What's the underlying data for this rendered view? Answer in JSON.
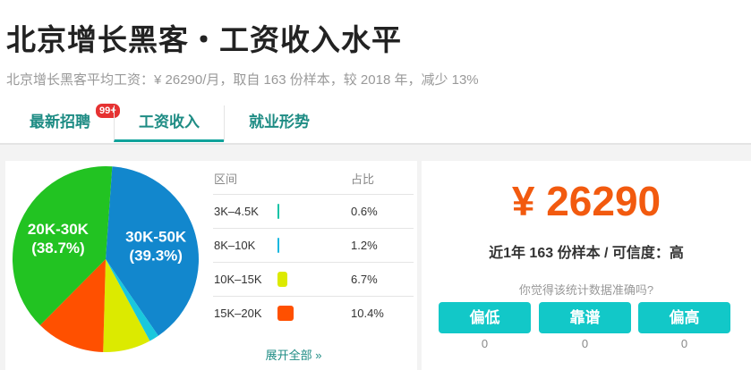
{
  "header": {
    "title": "北京增长黑客・工资收入水平",
    "subtitle": "北京增长黑客平均工资：¥ 26290/月，取自 163 份样本，较 2018 年，减少 13%"
  },
  "tabs": [
    {
      "label": "最新招聘",
      "badge": "99+"
    },
    {
      "label": "工资收入",
      "active": true
    },
    {
      "label": "就业形势"
    }
  ],
  "chart_data": {
    "type": "pie",
    "slices": [
      {
        "label": "30K-50K",
        "percent": 39.3,
        "color": "#1287cd"
      },
      {
        "label": "",
        "percent": 1.7,
        "color": "#19c8dd"
      },
      {
        "label": "",
        "percent": 8.3,
        "color": "#dcea00"
      },
      {
        "label": "",
        "percent": 12.0,
        "color": "#ff5000"
      },
      {
        "label": "20K-30K",
        "percent": 38.7,
        "color": "#22c322"
      }
    ]
  },
  "table": {
    "headers": [
      "区间",
      "占比"
    ],
    "rows": [
      {
        "range": "3K–4.5K",
        "percent": "0.6%",
        "value": 0.6,
        "color": "#11c3a6"
      },
      {
        "range": "8K–10K",
        "percent": "1.2%",
        "value": 1.2,
        "color": "#19b8e0"
      },
      {
        "range": "10K–15K",
        "percent": "6.7%",
        "value": 6.7,
        "color": "#dcea00"
      },
      {
        "range": "15K–20K",
        "percent": "10.4%",
        "value": 10.4,
        "color": "#ff5000"
      }
    ],
    "more_label": "展开全部 »"
  },
  "summary": {
    "salary": "¥ 26290",
    "sample": "近1年 163 份样本 / 可信度：高",
    "question": "你觉得该统计数据准确吗?",
    "votes": [
      {
        "label": "偏低",
        "count": "0"
      },
      {
        "label": "靠谱",
        "count": "0"
      },
      {
        "label": "偏高",
        "count": "0"
      }
    ]
  }
}
